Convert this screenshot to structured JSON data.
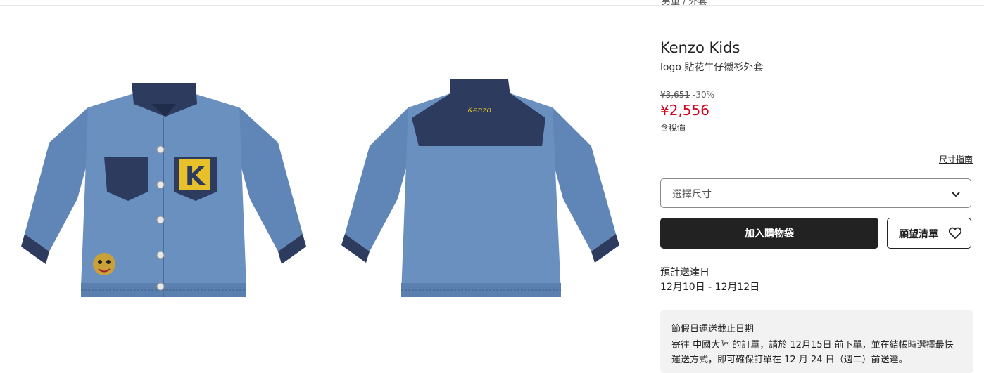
{
  "header": {
    "breadcrumb": "男童 / 外套"
  },
  "gallery": {
    "images": [
      {
        "label": "front-view"
      },
      {
        "label": "back-view"
      }
    ]
  },
  "product": {
    "brand": "Kenzo Kids",
    "name": "logo 貼花牛仔襯衫外套",
    "original_price": "¥3,651",
    "discount": "-30%",
    "price": "¥2,556",
    "tax_note": "含稅價"
  },
  "size": {
    "guide_link": "尺寸指南",
    "placeholder": "選擇尺寸"
  },
  "actions": {
    "add_to_bag": "加入購物袋",
    "wishlist": "願望清單"
  },
  "delivery": {
    "label": "預計送達日",
    "range": "12月10日 - 12月12日"
  },
  "holiday_notice": {
    "title": "節假日運送截止日期",
    "body": "寄往 中國大陸 的訂單，請於 12月15日 前下單，並在結帳時選擇最快運送方式，即可確保訂單在 12 月 24 日（週二）前送達。"
  },
  "colors": {
    "sale_red": "#d0021b",
    "button_dark": "#222222",
    "denim_light": "#5f86b7",
    "denim_dark": "#2c3b5e",
    "notice_bg": "#f2f2f2"
  }
}
